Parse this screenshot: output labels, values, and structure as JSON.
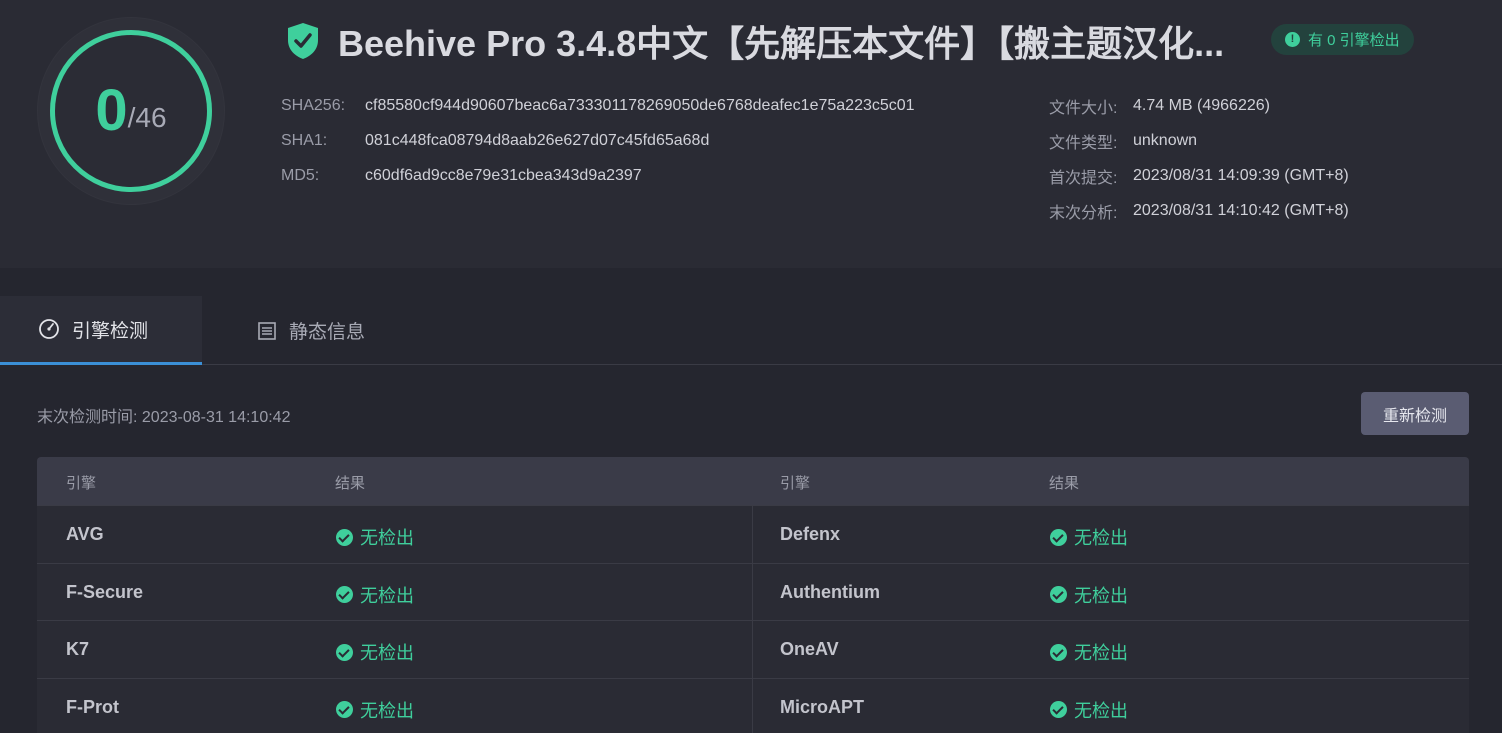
{
  "header": {
    "score": {
      "detected": "0",
      "total": "/46"
    },
    "title": "Beehive Pro 3.4.8中文【先解压本文件】【搬主题汉化...",
    "verdict_badge": "有 0 引擎检出",
    "hashes": [
      {
        "label": "SHA256:",
        "value": "cf85580cf944d90607beac6a733301178269050de6768deafec1e75a223c5c01"
      },
      {
        "label": "SHA1:",
        "value": "081c448fca08794d8aab26e627d07c45fd65a68d"
      },
      {
        "label": "MD5:",
        "value": "c60df6ad9cc8e79e31cbea343d9a2397"
      }
    ],
    "meta": [
      {
        "label": "文件大小:",
        "value": "4.74 MB (4966226)"
      },
      {
        "label": "文件类型:",
        "value": "unknown"
      },
      {
        "label": "首次提交:",
        "value": "2023/08/31 14:09:39 (GMT+8)"
      },
      {
        "label": "末次分析:",
        "value": "2023/08/31 14:10:42 (GMT+8)"
      }
    ]
  },
  "tabs": [
    {
      "label": "引擎检测",
      "active": true,
      "icon": "gauge-icon"
    },
    {
      "label": "静态信息",
      "active": false,
      "icon": "document-icon"
    }
  ],
  "content": {
    "last_scan": "末次检测时间: 2023-08-31 14:10:42",
    "rescan_label": "重新检测",
    "table": {
      "headers": [
        "引擎",
        "结果",
        "引擎",
        "结果"
      ],
      "rows": [
        {
          "left_engine": "AVG",
          "left_result": "无检出",
          "right_engine": "Defenx",
          "right_result": "无检出"
        },
        {
          "left_engine": "F-Secure",
          "left_result": "无检出",
          "right_engine": "Authentium",
          "right_result": "无检出"
        },
        {
          "left_engine": "K7",
          "left_result": "无检出",
          "right_engine": "OneAV",
          "right_result": "无检出"
        },
        {
          "left_engine": "F-Prot",
          "left_result": "无检出",
          "right_engine": "MicroAPT",
          "right_result": "无检出"
        }
      ]
    }
  },
  "colors": {
    "accent_green": "#3fcf9c",
    "tab_indicator": "#3b8fd6",
    "background": "#25262f"
  }
}
